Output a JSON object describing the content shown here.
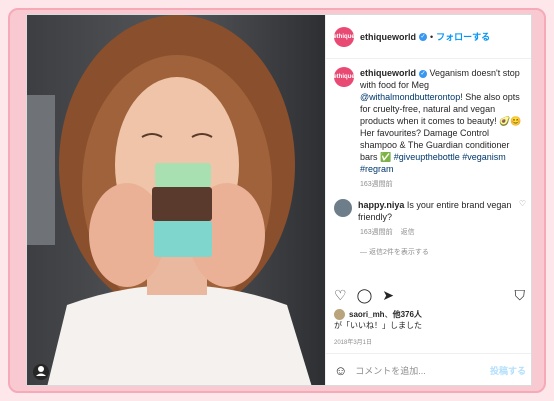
{
  "header": {
    "username": "ethiqueworld",
    "avatar_label": "ethique",
    "verified_mark": "✓",
    "follow": "フォローする",
    "separator": "•"
  },
  "caption": {
    "username": "ethiqueworld",
    "text1": "Veganism doesn't stop with food for Meg ",
    "mention": "@withalmondbutterontop",
    "text2": "! She also opts for cruelty-free, natural and vegan products when it comes to beauty! 🥑😊 Her favourites? Damage Control shampoo & The Guardian conditioner bars ✅ ",
    "hashtags": "#giveupthebottle #veganism #regram",
    "time": "163週間前"
  },
  "comment": {
    "username": "happy.niya",
    "text": "Is your entire brand vegan friendly?",
    "time": "163週間前",
    "reply": "返信",
    "view_replies": "返信2件を表示する"
  },
  "likes": {
    "user": "saori_mh",
    "other": "他376人",
    "text": "が「いいね！」しました"
  },
  "date": "2018年3月1日",
  "add_comment": {
    "placeholder": "コメントを追加...",
    "post": "投稿する"
  },
  "colors": {
    "accent": "#0095f6",
    "frame": "#f6a9b7",
    "brand": "#e84a74"
  }
}
